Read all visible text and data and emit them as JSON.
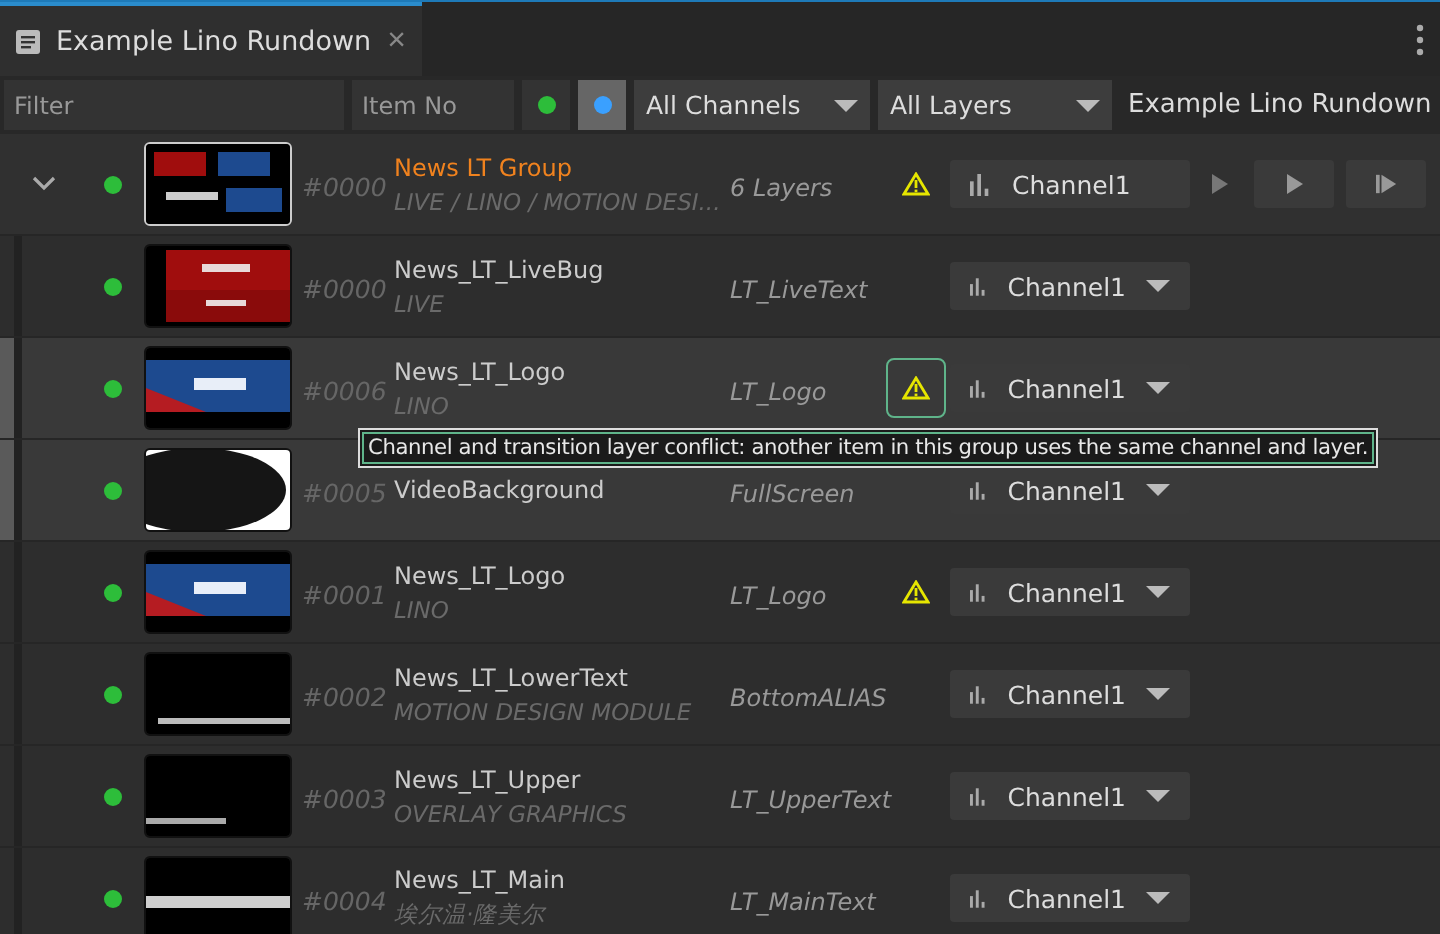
{
  "tab": {
    "title": "Example Lino Rundown",
    "close": "×"
  },
  "filter_bar": {
    "filter_placeholder": "Filter",
    "item_no_placeholder": "Item No",
    "green_filter_selected": false,
    "blue_filter_selected": true,
    "channels": "All Channels",
    "layers": "All Layers",
    "rundown_name": "Example Lino Rundown"
  },
  "group": {
    "expanded": true,
    "name": "News LT Group",
    "subtitle": "LIVE / LINO / MOTION DESI...",
    "number": "#0000",
    "layers": "6 Layers",
    "warning": true,
    "channel": "Channel1"
  },
  "items": [
    {
      "number": "#0000",
      "name": "News_LT_LiveBug",
      "subtitle": "LIVE",
      "layer": "LT_LiveText",
      "warning": false,
      "channel": "Channel1",
      "selected": false
    },
    {
      "number": "#0006",
      "name": "News_LT_Logo",
      "subtitle": "LINO",
      "layer": "LT_Logo",
      "warning": true,
      "warning_selected": true,
      "channel": "Channel1",
      "selected": true
    },
    {
      "number": "#0005",
      "name": "VideoBackground",
      "layer": "FullScreen",
      "warning": false,
      "channel": "Channel1",
      "selected": true
    },
    {
      "number": "#0001",
      "name": "News_LT_Logo",
      "subtitle": "LINO",
      "layer": "LT_Logo",
      "warning": true,
      "warning_selected": false,
      "channel": "Channel1",
      "selected": false
    },
    {
      "number": "#0002",
      "name": "News_LT_LowerText",
      "subtitle": "MOTION DESIGN MODULE",
      "layer": "BottomALIAS",
      "warning": false,
      "channel": "Channel1",
      "selected": false
    },
    {
      "number": "#0003",
      "name": "News_LT_Upper",
      "subtitle": "OVERLAY GRAPHICS",
      "layer": "LT_UpperText",
      "warning": false,
      "channel": "Channel1",
      "selected": false
    },
    {
      "number": "#0004",
      "name": "News_LT_Main",
      "subtitle": "埃尔温·隆美尔",
      "layer": "LT_MainText",
      "warning": false,
      "channel": "Channel1",
      "selected": false
    }
  ],
  "tooltip": "Channel and transition layer conflict: another item in this group uses the same channel and layer."
}
